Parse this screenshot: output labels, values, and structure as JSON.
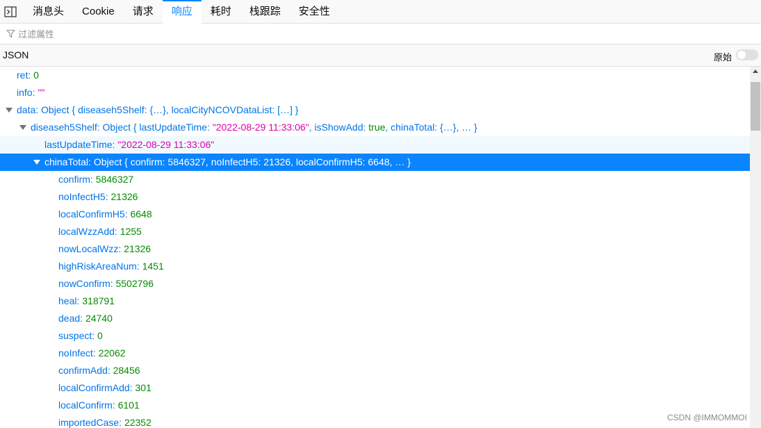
{
  "tabs": {
    "headers": "消息头",
    "cookies": "Cookie",
    "request": "请求",
    "response": "响应",
    "timings": "耗时",
    "stack": "栈跟踪",
    "security": "安全性"
  },
  "filter": {
    "placeholder": "过滤属性"
  },
  "json_header": {
    "title": "JSON",
    "raw_label": "原始",
    "raw_enabled": false
  },
  "tree": {
    "ret": {
      "key": "ret",
      "value": "0"
    },
    "info": {
      "key": "info",
      "value": "\"\""
    },
    "data": {
      "key": "data",
      "summary": "Object { diseaseh5Shelf: {…}, localCityNCOVDataList: […] }"
    },
    "shelf": {
      "key": "diseaseh5Shelf",
      "summary_pre": "Object { lastUpdateTime: ",
      "summary_time": "\"2022-08-29 11:33:06\"",
      "summary_mid": ", isShowAdd: ",
      "summary_bool": "true",
      "summary_post": ", chinaTotal: {…}, … }"
    },
    "lastUpdateTime": {
      "key": "lastUpdateTime",
      "value": "\"2022-08-29 11:33:06\""
    },
    "chinaTotal": {
      "key": "chinaTotal",
      "summary": "Object { confirm: 5846327, noInfectH5: 21326, localConfirmH5: 6648, … }"
    },
    "fields": [
      {
        "key": "confirm",
        "value": "5846327"
      },
      {
        "key": "noInfectH5",
        "value": "21326"
      },
      {
        "key": "localConfirmH5",
        "value": "6648"
      },
      {
        "key": "localWzzAdd",
        "value": "1255"
      },
      {
        "key": "nowLocalWzz",
        "value": "21326"
      },
      {
        "key": "highRiskAreaNum",
        "value": "1451"
      },
      {
        "key": "nowConfirm",
        "value": "5502796"
      },
      {
        "key": "heal",
        "value": "318791"
      },
      {
        "key": "dead",
        "value": "24740"
      },
      {
        "key": "suspect",
        "value": "0"
      },
      {
        "key": "noInfect",
        "value": "22062"
      },
      {
        "key": "confirmAdd",
        "value": "28456"
      },
      {
        "key": "localConfirmAdd",
        "value": "301"
      },
      {
        "key": "localConfirm",
        "value": "6101"
      },
      {
        "key": "importedCase",
        "value": "22352"
      }
    ]
  },
  "watermark": "CSDN @IMMOMMOI"
}
